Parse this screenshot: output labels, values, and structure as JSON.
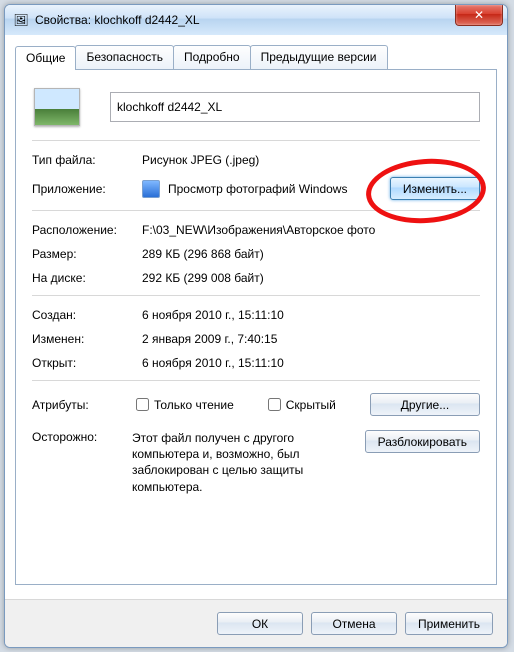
{
  "titlebar": {
    "icon_glyph": "🖼",
    "title": "Свойства: klochkoff d2442_XL",
    "close_glyph": "✕"
  },
  "tabs": {
    "general": "Общие",
    "security": "Безопасность",
    "details": "Подробно",
    "previous": "Предыдущие версии"
  },
  "filename": "klochkoff d2442_XL",
  "labels": {
    "filetype": "Тип файла:",
    "app": "Приложение:",
    "location": "Расположение:",
    "size": "Размер:",
    "ondisk": "На диске:",
    "created": "Создан:",
    "modified": "Изменен:",
    "accessed": "Открыт:",
    "attributes": "Атрибуты:",
    "warning_k": "Осторожно:"
  },
  "values": {
    "filetype": "Рисунок JPEG (.jpeg)",
    "app": "Просмотр фотографий Windows",
    "location": "F:\\03_NEW\\Изображения\\Авторское фото",
    "size": "289 КБ (296 868 байт)",
    "ondisk": "292 КБ (299 008 байт)",
    "created": "6 ноября 2010 г., 15:11:10",
    "modified": "2 января 2009 г., 7:40:15",
    "accessed": "6 ноября 2010 г., 15:11:10",
    "warning": "Этот файл получен с другого компьютера и, возможно, был заблокирован с целью защиты компьютера."
  },
  "checkboxes": {
    "readonly": "Только чтение",
    "hidden": "Скрытый"
  },
  "buttons": {
    "change": "Изменить...",
    "other": "Другие...",
    "unblock": "Разблокировать",
    "ok": "ОК",
    "cancel": "Отмена",
    "apply": "Применить"
  }
}
